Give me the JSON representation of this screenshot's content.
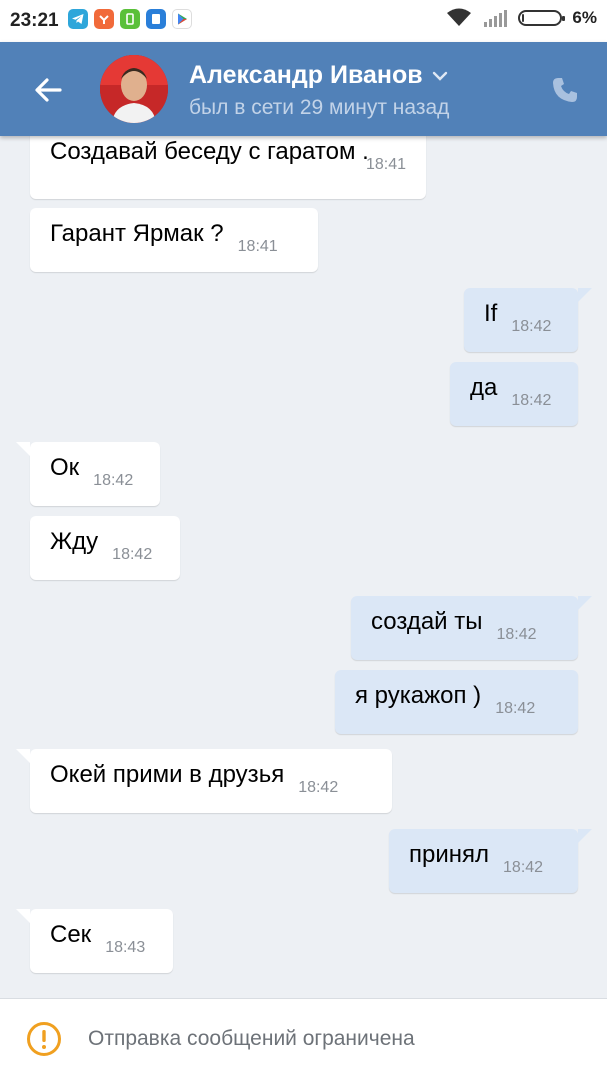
{
  "statusbar": {
    "time": "23:21",
    "battery": "6%",
    "battery_level": 0.06,
    "app_icons": [
      "telegram-icon",
      "mi-icon",
      "battery-saver-icon",
      "files-icon",
      "google-play-icon"
    ]
  },
  "header": {
    "contact_name": "Александр Иванов",
    "last_seen": "был в сети 29 минут назад",
    "accent_color": "#5181b8"
  },
  "messages": [
    {
      "direction": "in",
      "text": "Создавай беседу с гаратом .",
      "time": "18:41"
    },
    {
      "direction": "in",
      "text": "Гарант Ярмак ?",
      "time": "18:41"
    },
    {
      "direction": "out",
      "text": "If",
      "time": "18:42"
    },
    {
      "direction": "out",
      "text": "да",
      "time": "18:42"
    },
    {
      "direction": "in",
      "text": "Ок",
      "time": "18:42"
    },
    {
      "direction": "in",
      "text": "Жду",
      "time": "18:42"
    },
    {
      "direction": "out",
      "text": "создай ты",
      "time": "18:42"
    },
    {
      "direction": "out",
      "text": "я рукажоп )",
      "time": "18:42"
    },
    {
      "direction": "in",
      "text": "Окей прими в друзья",
      "time": "18:42"
    },
    {
      "direction": "out",
      "text": "принял",
      "time": "18:42"
    },
    {
      "direction": "in",
      "text": "Сек",
      "time": "18:43"
    }
  ],
  "bottom": {
    "notice": "Отправка сообщений ограничена",
    "warning_color": "#f0a020"
  }
}
